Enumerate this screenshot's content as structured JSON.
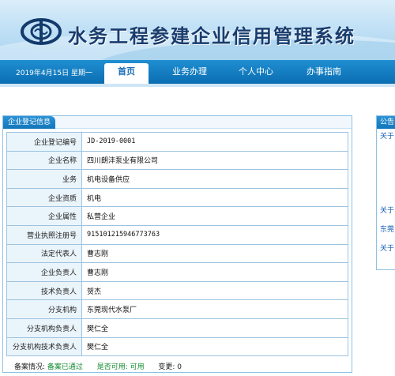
{
  "site": {
    "title": "水务工程参建企业信用管理系统"
  },
  "nav": {
    "date": "2019年4月15日 星期一",
    "tabs": [
      {
        "label": "首页",
        "active": true
      },
      {
        "label": "业务办理",
        "active": false
      },
      {
        "label": "个人中心",
        "active": false
      },
      {
        "label": "办事指南",
        "active": false
      }
    ]
  },
  "panel": {
    "title": "企业登记信息",
    "rows": [
      {
        "label": "企业登记编号",
        "value": "JD-2019-0001"
      },
      {
        "label": "企业名称",
        "value": "四川朗沣泵业有限公司"
      },
      {
        "label": "业务",
        "value": "机电设备供应"
      },
      {
        "label": "企业资质",
        "value": "机电"
      },
      {
        "label": "企业属性",
        "value": "私营企业"
      },
      {
        "label": "营业执照注册号",
        "value": "915101215946773763"
      },
      {
        "label": "法定代表人",
        "value": "曹志刚"
      },
      {
        "label": "企业负责人",
        "value": "曹志刚"
      },
      {
        "label": "技术负责人",
        "value": "贺杰"
      },
      {
        "label": "分支机构",
        "value": "东莞现代水泵厂"
      },
      {
        "label": "分支机构负责人",
        "value": "樊仁全"
      },
      {
        "label": "分支机构技术负责人",
        "value": "樊仁全"
      }
    ],
    "status": {
      "record_label": "备案情况:",
      "record_value": "备案已通过",
      "usable_label": "是否可用:",
      "usable_value": "可用",
      "change_label": "变更:",
      "change_value": "0"
    }
  },
  "notice": {
    "title": "公告",
    "items": [
      "关于",
      "关于",
      "东莞",
      "关于"
    ]
  },
  "colors": {
    "nav_bg": "#1275bd",
    "accent_green": "#118a2e",
    "link_blue": "#1a5fb4",
    "label_bg": "#eaf4fb"
  }
}
